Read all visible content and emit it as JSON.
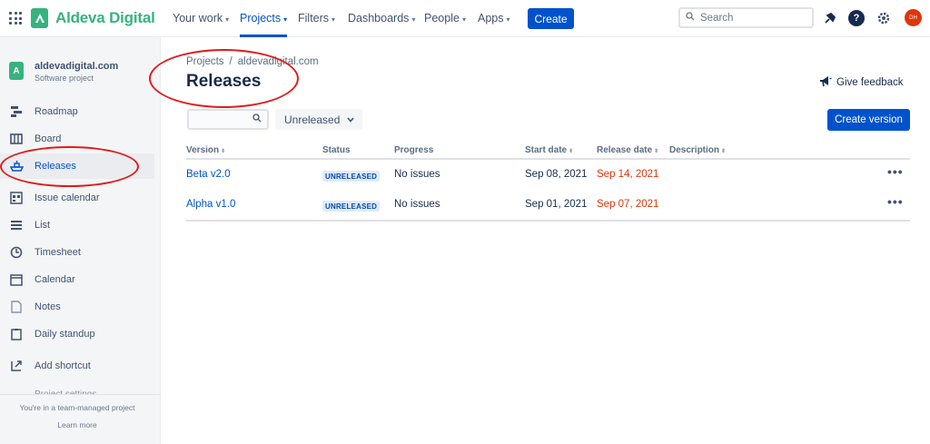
{
  "topnav": {
    "brand": "Aldeva Digital",
    "items": [
      {
        "label": "Your work"
      },
      {
        "label": "Projects"
      },
      {
        "label": "Filters"
      },
      {
        "label": "Dashboards"
      },
      {
        "label": "People"
      },
      {
        "label": "Apps"
      }
    ],
    "create_label": "Create",
    "search_placeholder": "Search",
    "avatar_initials": "DH"
  },
  "sidebar": {
    "project_name": "aldevadigital.com",
    "project_type": "Software project",
    "items": [
      {
        "label": "Roadmap",
        "icon": "roadmap-icon"
      },
      {
        "label": "Board",
        "icon": "board-icon"
      },
      {
        "label": "Releases",
        "icon": "ship-icon",
        "active": true
      },
      {
        "label": "Issue calendar",
        "icon": "calendar-grid-icon"
      },
      {
        "label": "List",
        "icon": "list-icon"
      },
      {
        "label": "Timesheet",
        "icon": "clock-icon"
      },
      {
        "label": "Calendar",
        "icon": "calendar-icon"
      },
      {
        "label": "Notes",
        "icon": "notes-icon"
      },
      {
        "label": "Daily standup",
        "icon": "clipboard-icon"
      },
      {
        "label": "Add shortcut",
        "icon": "add-shortcut-icon"
      }
    ],
    "cut_item": "Project settings",
    "footer_text": "You're in a team-managed project",
    "footer_link": "Learn more"
  },
  "main": {
    "breadcrumb": {
      "root": "Projects",
      "separator": "/",
      "current": "aldevadigital.com"
    },
    "title": "Releases",
    "feedback_label": "Give feedback",
    "status_filter": "Unreleased",
    "create_version_label": "Create version",
    "columns": [
      "Version",
      "Status",
      "Progress",
      "Start date",
      "Release date",
      "Description"
    ],
    "rows": [
      {
        "version": "Beta v2.0",
        "status": "UNRELEASED",
        "progress": "No issues",
        "start": "Sep 08, 2021",
        "release": "Sep 14, 2021",
        "description": ""
      },
      {
        "version": "Alpha v1.0",
        "status": "UNRELEASED",
        "progress": "No issues",
        "start": "Sep 01, 2021",
        "release": "Sep 07, 2021",
        "description": ""
      }
    ]
  },
  "colors": {
    "brand_green": "#36b37e",
    "primary_blue": "#0052cc",
    "overdue_red": "#de350b",
    "annotation_red": "#e01b1b"
  }
}
